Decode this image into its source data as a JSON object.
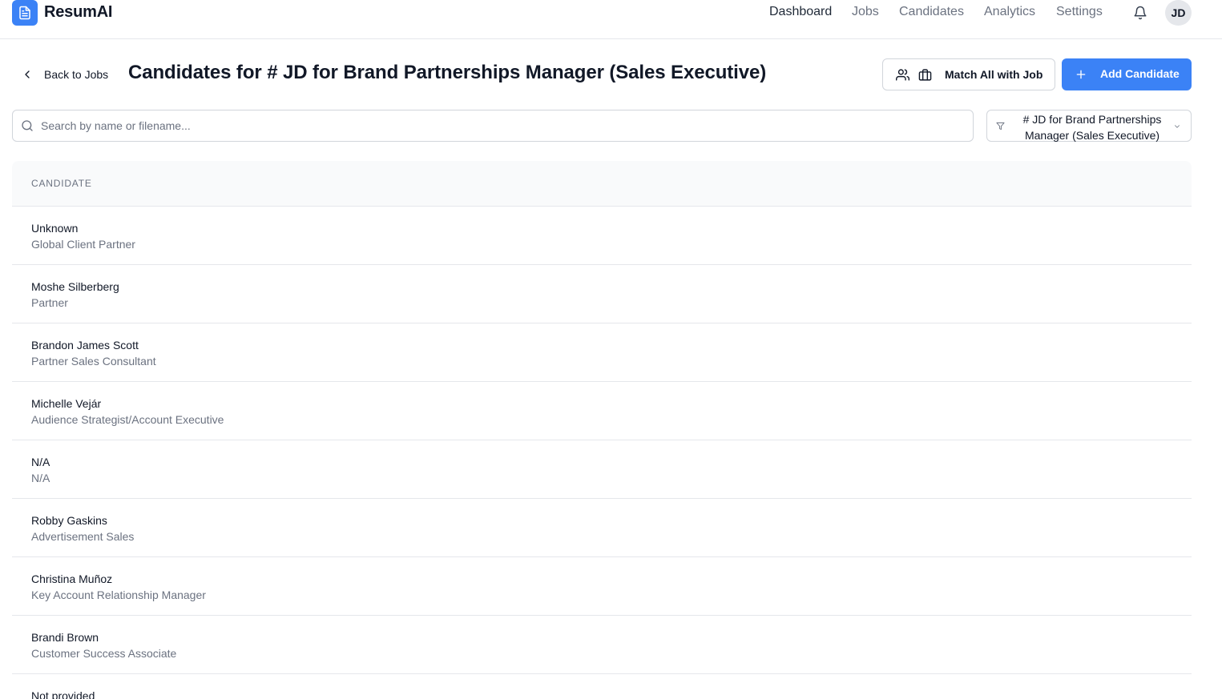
{
  "app": {
    "name": "ResumAI",
    "logo_icon": "document-icon",
    "accent_color": "#3b82f6"
  },
  "nav": {
    "links": [
      {
        "label": "Dashboard",
        "active": true
      },
      {
        "label": "Jobs",
        "active": false
      },
      {
        "label": "Candidates",
        "active": false
      },
      {
        "label": "Analytics",
        "active": false
      },
      {
        "label": "Settings",
        "active": false
      }
    ],
    "notification_icon": "bell-icon",
    "avatar_initials": "JD"
  },
  "header": {
    "back_label": "Back to Jobs",
    "title": "Candidates for # JD for Brand Partnerships Manager (Sales Executive)",
    "match_button_label": "Match All with Job",
    "add_button_label": "Add Candidate"
  },
  "search": {
    "placeholder": "Search by name or filename...",
    "value": ""
  },
  "filter": {
    "selected": "# JD for Brand Partnerships Manager (Sales Executive)"
  },
  "table": {
    "column_header": "CANDIDATE",
    "rows": [
      {
        "name": "Unknown",
        "title": "Global Client Partner"
      },
      {
        "name": "Moshe Silberberg",
        "title": "Partner"
      },
      {
        "name": "Brandon James Scott",
        "title": "Partner Sales Consultant"
      },
      {
        "name": "Michelle Vejár",
        "title": "Audience Strategist/Account Executive"
      },
      {
        "name": "N/A",
        "title": "N/A"
      },
      {
        "name": "Robby Gaskins",
        "title": "Advertisement Sales"
      },
      {
        "name": "Christina Muñoz",
        "title": "Key Account Relationship Manager"
      },
      {
        "name": "Brandi Brown",
        "title": "Customer Success Associate"
      },
      {
        "name": "Not provided",
        "title": ""
      }
    ]
  }
}
